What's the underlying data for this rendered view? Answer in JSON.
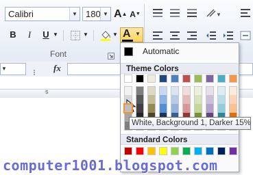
{
  "ribbon": {
    "font_name": "Calibri",
    "font_size": "180",
    "grow_font": "A",
    "shrink_font": "A",
    "bold": "B",
    "italic": "I",
    "underline": "U",
    "font_color_letter": "A",
    "group_label": "Font"
  },
  "formula_bar": {
    "fx": "fx"
  },
  "column_header_mark": "s",
  "color_menu": {
    "automatic_label": "Automatic",
    "theme_title": "Theme Colors",
    "standard_title": "Standard Colors",
    "theme_base": [
      "#ffffff",
      "#000000",
      "#eeece1",
      "#1f497d",
      "#4f81bd",
      "#c0504d",
      "#9bbb59",
      "#8064a2",
      "#4bacc6",
      "#f79646"
    ],
    "theme_shades": [
      [
        "#f2f2f2",
        "#d9d9d9",
        "#bfbfbf",
        "#a6a6a6",
        "#808080"
      ],
      [
        "#7f7f7f",
        "#595959",
        "#404040",
        "#262626",
        "#0d0d0d"
      ],
      [
        "#ddd9c3",
        "#c4bd97",
        "#948a54",
        "#4a452a",
        "#1e1c11"
      ],
      [
        "#c6d9f0",
        "#8db3e2",
        "#548dd4",
        "#17365d",
        "#0f243e"
      ],
      [
        "#dbe5f1",
        "#b8cce4",
        "#95b3d7",
        "#366092",
        "#244061"
      ],
      [
        "#f2dcdb",
        "#e5b9b7",
        "#d99694",
        "#953734",
        "#632423"
      ],
      [
        "#ebf1dd",
        "#d7e3bc",
        "#c3d69b",
        "#76923c",
        "#4f6128"
      ],
      [
        "#e5e0ec",
        "#ccc1d9",
        "#b2a2c7",
        "#5f497a",
        "#3f3151"
      ],
      [
        "#dbeef3",
        "#b7dde8",
        "#92cddc",
        "#31859b",
        "#205867"
      ],
      [
        "#fdeada",
        "#fbd5b5",
        "#fac08f",
        "#e36c09",
        "#974806"
      ]
    ],
    "standard_colors": [
      "#c00000",
      "#ff0000",
      "#ffc000",
      "#ffff00",
      "#92d050",
      "#00b050",
      "#00b0f0",
      "#0070c0",
      "#002060",
      "#7030a0"
    ]
  },
  "tooltip": "White, Background 1, Darker 15%",
  "watermark": "computer1001.blogspot.com"
}
